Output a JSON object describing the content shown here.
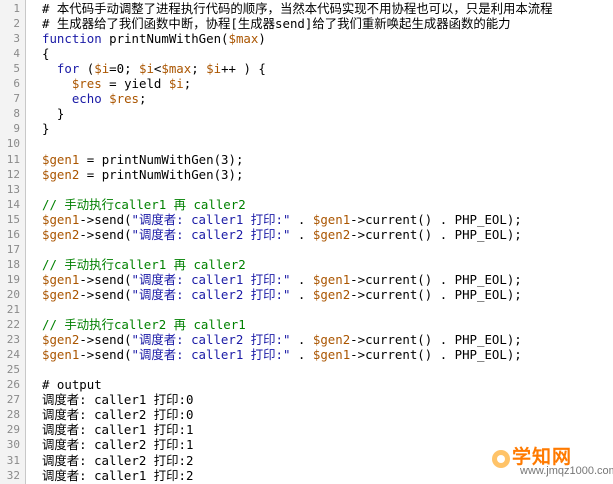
{
  "lines": [
    {
      "num": "1",
      "parts": [
        {
          "c": "bk",
          "t": "# 本代码手动调整了进程执行代码的顺序，当然本代码实现不用协程也可以，只是利用本流程"
        }
      ]
    },
    {
      "num": "2",
      "parts": [
        {
          "c": "bk",
          "t": "# 生成器给了我们函数中断，协程[生成器send]给了我们重新唤起生成器函数的能力"
        }
      ]
    },
    {
      "num": "3",
      "parts": [
        {
          "c": "kw",
          "t": "function"
        },
        {
          "c": "bk",
          "t": " printNumWithGen("
        },
        {
          "c": "var",
          "t": "$max"
        },
        {
          "c": "bk",
          "t": ")"
        }
      ]
    },
    {
      "num": "4",
      "parts": [
        {
          "c": "bk",
          "t": "{"
        }
      ]
    },
    {
      "num": "5",
      "parts": [
        {
          "c": "bk",
          "t": "  "
        },
        {
          "c": "kw",
          "t": "for"
        },
        {
          "c": "bk",
          "t": " ("
        },
        {
          "c": "var",
          "t": "$i"
        },
        {
          "c": "bk",
          "t": "=0; "
        },
        {
          "c": "var",
          "t": "$i"
        },
        {
          "c": "bk",
          "t": "<"
        },
        {
          "c": "var",
          "t": "$max"
        },
        {
          "c": "bk",
          "t": "; "
        },
        {
          "c": "var",
          "t": "$i"
        },
        {
          "c": "bk",
          "t": "++ ) {"
        }
      ]
    },
    {
      "num": "6",
      "parts": [
        {
          "c": "bk",
          "t": "    "
        },
        {
          "c": "var",
          "t": "$res"
        },
        {
          "c": "bk",
          "t": " = yield "
        },
        {
          "c": "var",
          "t": "$i"
        },
        {
          "c": "bk",
          "t": ";"
        }
      ]
    },
    {
      "num": "7",
      "parts": [
        {
          "c": "bk",
          "t": "    "
        },
        {
          "c": "kw",
          "t": "echo"
        },
        {
          "c": "bk",
          "t": " "
        },
        {
          "c": "var",
          "t": "$res"
        },
        {
          "c": "bk",
          "t": ";"
        }
      ]
    },
    {
      "num": "8",
      "parts": [
        {
          "c": "bk",
          "t": "  }"
        }
      ]
    },
    {
      "num": "9",
      "parts": [
        {
          "c": "bk",
          "t": "}"
        }
      ]
    },
    {
      "num": "10",
      "parts": []
    },
    {
      "num": "11",
      "parts": [
        {
          "c": "var",
          "t": "$gen1"
        },
        {
          "c": "bk",
          "t": " = printNumWithGen(3);"
        }
      ]
    },
    {
      "num": "12",
      "parts": [
        {
          "c": "var",
          "t": "$gen2"
        },
        {
          "c": "bk",
          "t": " = printNumWithGen(3);"
        }
      ]
    },
    {
      "num": "13",
      "parts": []
    },
    {
      "num": "14",
      "parts": [
        {
          "c": "cm",
          "t": "// 手动执行caller1 再 caller2"
        }
      ]
    },
    {
      "num": "15",
      "parts": [
        {
          "c": "var",
          "t": "$gen1"
        },
        {
          "c": "bk",
          "t": "->send("
        },
        {
          "c": "str",
          "t": "\"调度者: caller1 打印:\""
        },
        {
          "c": "bk",
          "t": " . "
        },
        {
          "c": "var",
          "t": "$gen1"
        },
        {
          "c": "bk",
          "t": "->current() . PHP_EOL);"
        }
      ]
    },
    {
      "num": "16",
      "parts": [
        {
          "c": "var",
          "t": "$gen2"
        },
        {
          "c": "bk",
          "t": "->send("
        },
        {
          "c": "str",
          "t": "\"调度者: caller2 打印:\""
        },
        {
          "c": "bk",
          "t": " . "
        },
        {
          "c": "var",
          "t": "$gen2"
        },
        {
          "c": "bk",
          "t": "->current() . PHP_EOL);"
        }
      ]
    },
    {
      "num": "17",
      "parts": []
    },
    {
      "num": "18",
      "parts": [
        {
          "c": "cm",
          "t": "// 手动执行caller1 再 caller2"
        }
      ]
    },
    {
      "num": "19",
      "parts": [
        {
          "c": "var",
          "t": "$gen1"
        },
        {
          "c": "bk",
          "t": "->send("
        },
        {
          "c": "str",
          "t": "\"调度者: caller1 打印:\""
        },
        {
          "c": "bk",
          "t": " . "
        },
        {
          "c": "var",
          "t": "$gen1"
        },
        {
          "c": "bk",
          "t": "->current() . PHP_EOL);"
        }
      ]
    },
    {
      "num": "20",
      "parts": [
        {
          "c": "var",
          "t": "$gen2"
        },
        {
          "c": "bk",
          "t": "->send("
        },
        {
          "c": "str",
          "t": "\"调度者: caller2 打印:\""
        },
        {
          "c": "bk",
          "t": " . "
        },
        {
          "c": "var",
          "t": "$gen2"
        },
        {
          "c": "bk",
          "t": "->current() . PHP_EOL);"
        }
      ]
    },
    {
      "num": "21",
      "parts": []
    },
    {
      "num": "22",
      "parts": [
        {
          "c": "cm",
          "t": "// 手动执行caller2 再 caller1"
        }
      ]
    },
    {
      "num": "23",
      "parts": [
        {
          "c": "var",
          "t": "$gen2"
        },
        {
          "c": "bk",
          "t": "->send("
        },
        {
          "c": "str",
          "t": "\"调度者: caller2 打印:\""
        },
        {
          "c": "bk",
          "t": " . "
        },
        {
          "c": "var",
          "t": "$gen2"
        },
        {
          "c": "bk",
          "t": "->current() . PHP_EOL);"
        }
      ]
    },
    {
      "num": "24",
      "parts": [
        {
          "c": "var",
          "t": "$gen1"
        },
        {
          "c": "bk",
          "t": "->send("
        },
        {
          "c": "str",
          "t": "\"调度者: caller1 打印:\""
        },
        {
          "c": "bk",
          "t": " . "
        },
        {
          "c": "var",
          "t": "$gen1"
        },
        {
          "c": "bk",
          "t": "->current() . PHP_EOL);"
        }
      ]
    },
    {
      "num": "25",
      "parts": []
    },
    {
      "num": "26",
      "parts": [
        {
          "c": "bk",
          "t": "# output"
        }
      ]
    },
    {
      "num": "27",
      "parts": [
        {
          "c": "bk",
          "t": "调度者: caller1 打印:0"
        }
      ]
    },
    {
      "num": "28",
      "parts": [
        {
          "c": "bk",
          "t": "调度者: caller2 打印:0"
        }
      ]
    },
    {
      "num": "29",
      "parts": [
        {
          "c": "bk",
          "t": "调度者: caller1 打印:1"
        }
      ]
    },
    {
      "num": "30",
      "parts": [
        {
          "c": "bk",
          "t": "调度者: caller2 打印:1"
        }
      ]
    },
    {
      "num": "31",
      "parts": [
        {
          "c": "bk",
          "t": "调度者: caller2 打印:2"
        }
      ]
    },
    {
      "num": "32",
      "parts": [
        {
          "c": "bk",
          "t": "调度者: caller1 打印:2"
        }
      ]
    }
  ],
  "watermark": {
    "name": "学知网",
    "url": "www.jmqz1000.com"
  },
  "colors": {
    "keyword": "#1a1aa6",
    "variable": "#aa5500",
    "comment": "#008000",
    "string": "#1a1aa6",
    "gutter": "#f3f3f3",
    "line_number": "#8a8a8a"
  }
}
